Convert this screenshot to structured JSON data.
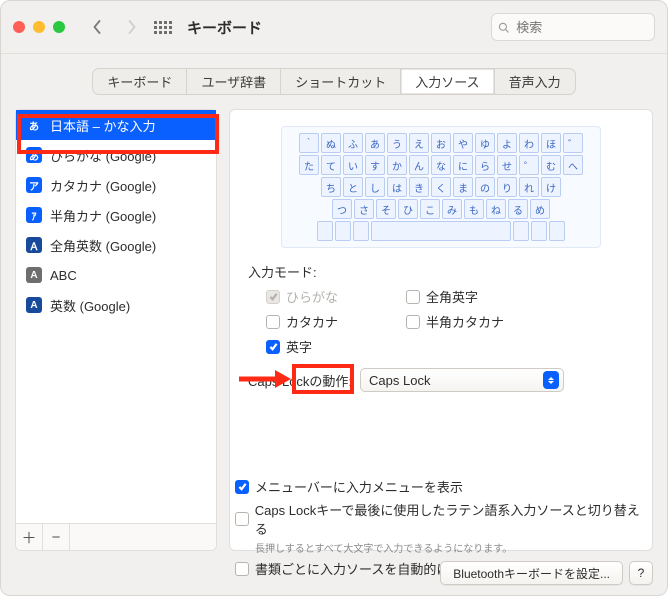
{
  "header": {
    "title": "キーボード",
    "search_placeholder": "検索"
  },
  "tabs": [
    "キーボード",
    "ユーザ辞書",
    "ショートカット",
    "入力ソース",
    "音声入力"
  ],
  "active_tab_index": 3,
  "sources": [
    {
      "badge": "あ",
      "badge_class": "b-blue",
      "label": "日本語 – かな入力"
    },
    {
      "badge": "あ",
      "badge_class": "b-blue",
      "label": "ひらがな (Google)"
    },
    {
      "badge": "ア",
      "badge_class": "b-blue",
      "label": "カタカナ (Google)"
    },
    {
      "badge": "ｱ",
      "badge_class": "b-blue",
      "label": "半角カナ (Google)"
    },
    {
      "badge": "Ａ",
      "badge_class": "b-darkblue",
      "label": "全角英数 (Google)"
    },
    {
      "badge": "A",
      "badge_class": "b-grey",
      "label": "ABC"
    },
    {
      "badge": "A",
      "badge_class": "b-darkblue",
      "label": "英数 (Google)"
    }
  ],
  "selected_source_index": 0,
  "keyboard_rows": [
    [
      "｀",
      "ぬ",
      "ふ",
      "あ",
      "う",
      "え",
      "お",
      "や",
      "ゆ",
      "よ",
      "わ",
      "ほ",
      "゛"
    ],
    [
      "た",
      "て",
      "い",
      "す",
      "か",
      "ん",
      "な",
      "に",
      "ら",
      "せ",
      "゜",
      "む",
      "へ"
    ],
    [
      "ち",
      "と",
      "し",
      "は",
      "き",
      "く",
      "ま",
      "の",
      "り",
      "れ",
      "け"
    ],
    [
      "つ",
      "さ",
      "そ",
      "ひ",
      "こ",
      "み",
      "も",
      "ね",
      "る",
      "め"
    ]
  ],
  "input_mode_label": "入力モード:",
  "modes": {
    "hiragana": {
      "label": "ひらがな",
      "checked": true,
      "disabled": true
    },
    "zenkaku": {
      "label": "全角英字",
      "checked": false,
      "disabled": false
    },
    "katakana": {
      "label": "カタカナ",
      "checked": false,
      "disabled": false
    },
    "hankata": {
      "label": "半角カタカナ",
      "checked": false,
      "disabled": false
    },
    "eiji": {
      "label": "英字",
      "checked": true,
      "disabled": false
    }
  },
  "caps_lock": {
    "label": "Caps Lockの動作:",
    "value": "Caps Lock"
  },
  "global_options": {
    "show_menu": {
      "label": "メニューバーに入力メニューを表示",
      "checked": true
    },
    "caps_switch": {
      "label": "Caps Lockキーで最後に使用したラテン語系入力ソースと切り替える",
      "hint": "長押しするとすべて大文字で入力できるようになります。",
      "checked": false
    },
    "per_document": {
      "label": "書類ごとに入力ソースを自動的に切り替える",
      "checked": false
    }
  },
  "footer": {
    "bluetooth": "Bluetoothキーボードを設定...",
    "help": "?"
  },
  "add_label": "＋",
  "remove_label": "−"
}
